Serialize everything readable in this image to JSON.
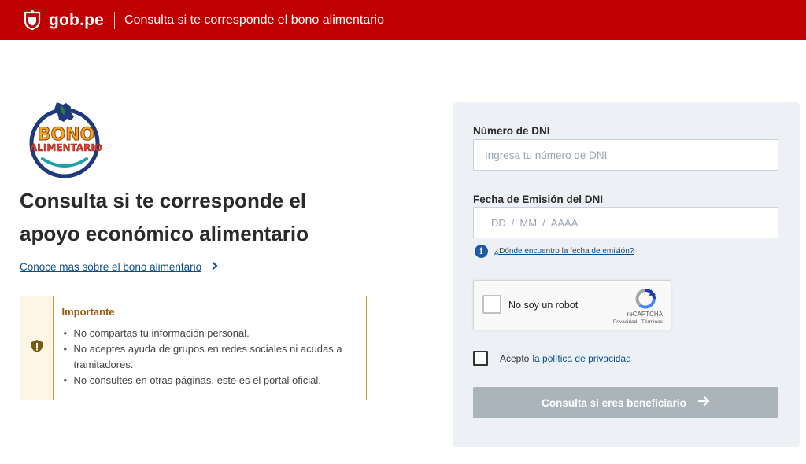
{
  "header": {
    "brand": "gob.pe",
    "title": "Consulta si te corresponde el bono alimentario",
    "background": "#c00000"
  },
  "logo": {
    "line1": "BONO",
    "line2": "ALIMENTARIO"
  },
  "main": {
    "title": "Consulta si te corresponde el apoyo económico alimentario",
    "more_link": "Conoce mas sobre el bono alimentario"
  },
  "notice": {
    "title": "Importante",
    "items": [
      "No compartas tu información personal.",
      "No aceptes ayuda de grupos en redes sociales ni acudas a tramitadores.",
      "No consultes en otras páginas, este es el portal oficial."
    ],
    "accent": "#c29b3a"
  },
  "form": {
    "dni_label": "Número de DNI",
    "dni_placeholder": "Ingresa tu número de DNI",
    "date_label": "Fecha de Emisión del DNI",
    "date_day": "DD",
    "date_month": "MM",
    "date_year": "AAAA",
    "date_separator": "/",
    "help_link": "¿Dónde encuentro la fecha de emisión?",
    "captcha_label": "No soy un robot",
    "captcha_brand": "reCAPTCHA",
    "captcha_terms": "Privacidad - Términos",
    "accept_text": "Acepto",
    "accept_link": "la política de privacidad",
    "submit_label": "Consulta si eres beneficiario",
    "submit_color": "#aab4ba"
  }
}
